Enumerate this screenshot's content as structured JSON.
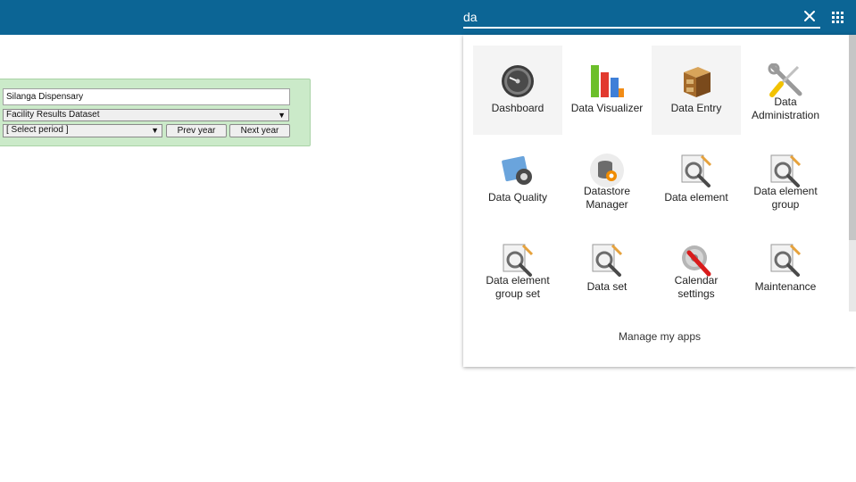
{
  "header": {
    "search_value": "da",
    "clear_icon": "close-icon",
    "apps_icon": "apps-grid-icon",
    "background_color": "#0c6595"
  },
  "form": {
    "org_unit": "Silanga Dispensary",
    "dataset": "Facility Results Dataset",
    "period": "[ Select period ]",
    "prev_label": "Prev year",
    "next_label": "Next year",
    "panel_color": "#cbeac9"
  },
  "apps": [
    {
      "label": "Dashboard",
      "icon": "dashboard-gauge-icon"
    },
    {
      "label": "Data Visualizer",
      "icon": "bar-chart-icon"
    },
    {
      "label": "Data Entry",
      "icon": "filing-cabinet-icon"
    },
    {
      "label": "Data Administration",
      "icon": "wrench-screwdriver-icon"
    },
    {
      "label": "Data Quality",
      "icon": "data-quality-gear-icon"
    },
    {
      "label": "Datastore Manager",
      "icon": "database-gear-icon"
    },
    {
      "label": "Data element",
      "icon": "magnifier-document-icon"
    },
    {
      "label": "Data element group",
      "icon": "magnifier-document-icon"
    },
    {
      "label": "Data element group set",
      "icon": "magnifier-document-icon"
    },
    {
      "label": "Data set",
      "icon": "magnifier-document-icon"
    },
    {
      "label": "Calendar settings",
      "icon": "settings-gear-icon"
    },
    {
      "label": "Maintenance",
      "icon": "magnifier-document-icon"
    }
  ],
  "manage_label": "Manage my apps"
}
